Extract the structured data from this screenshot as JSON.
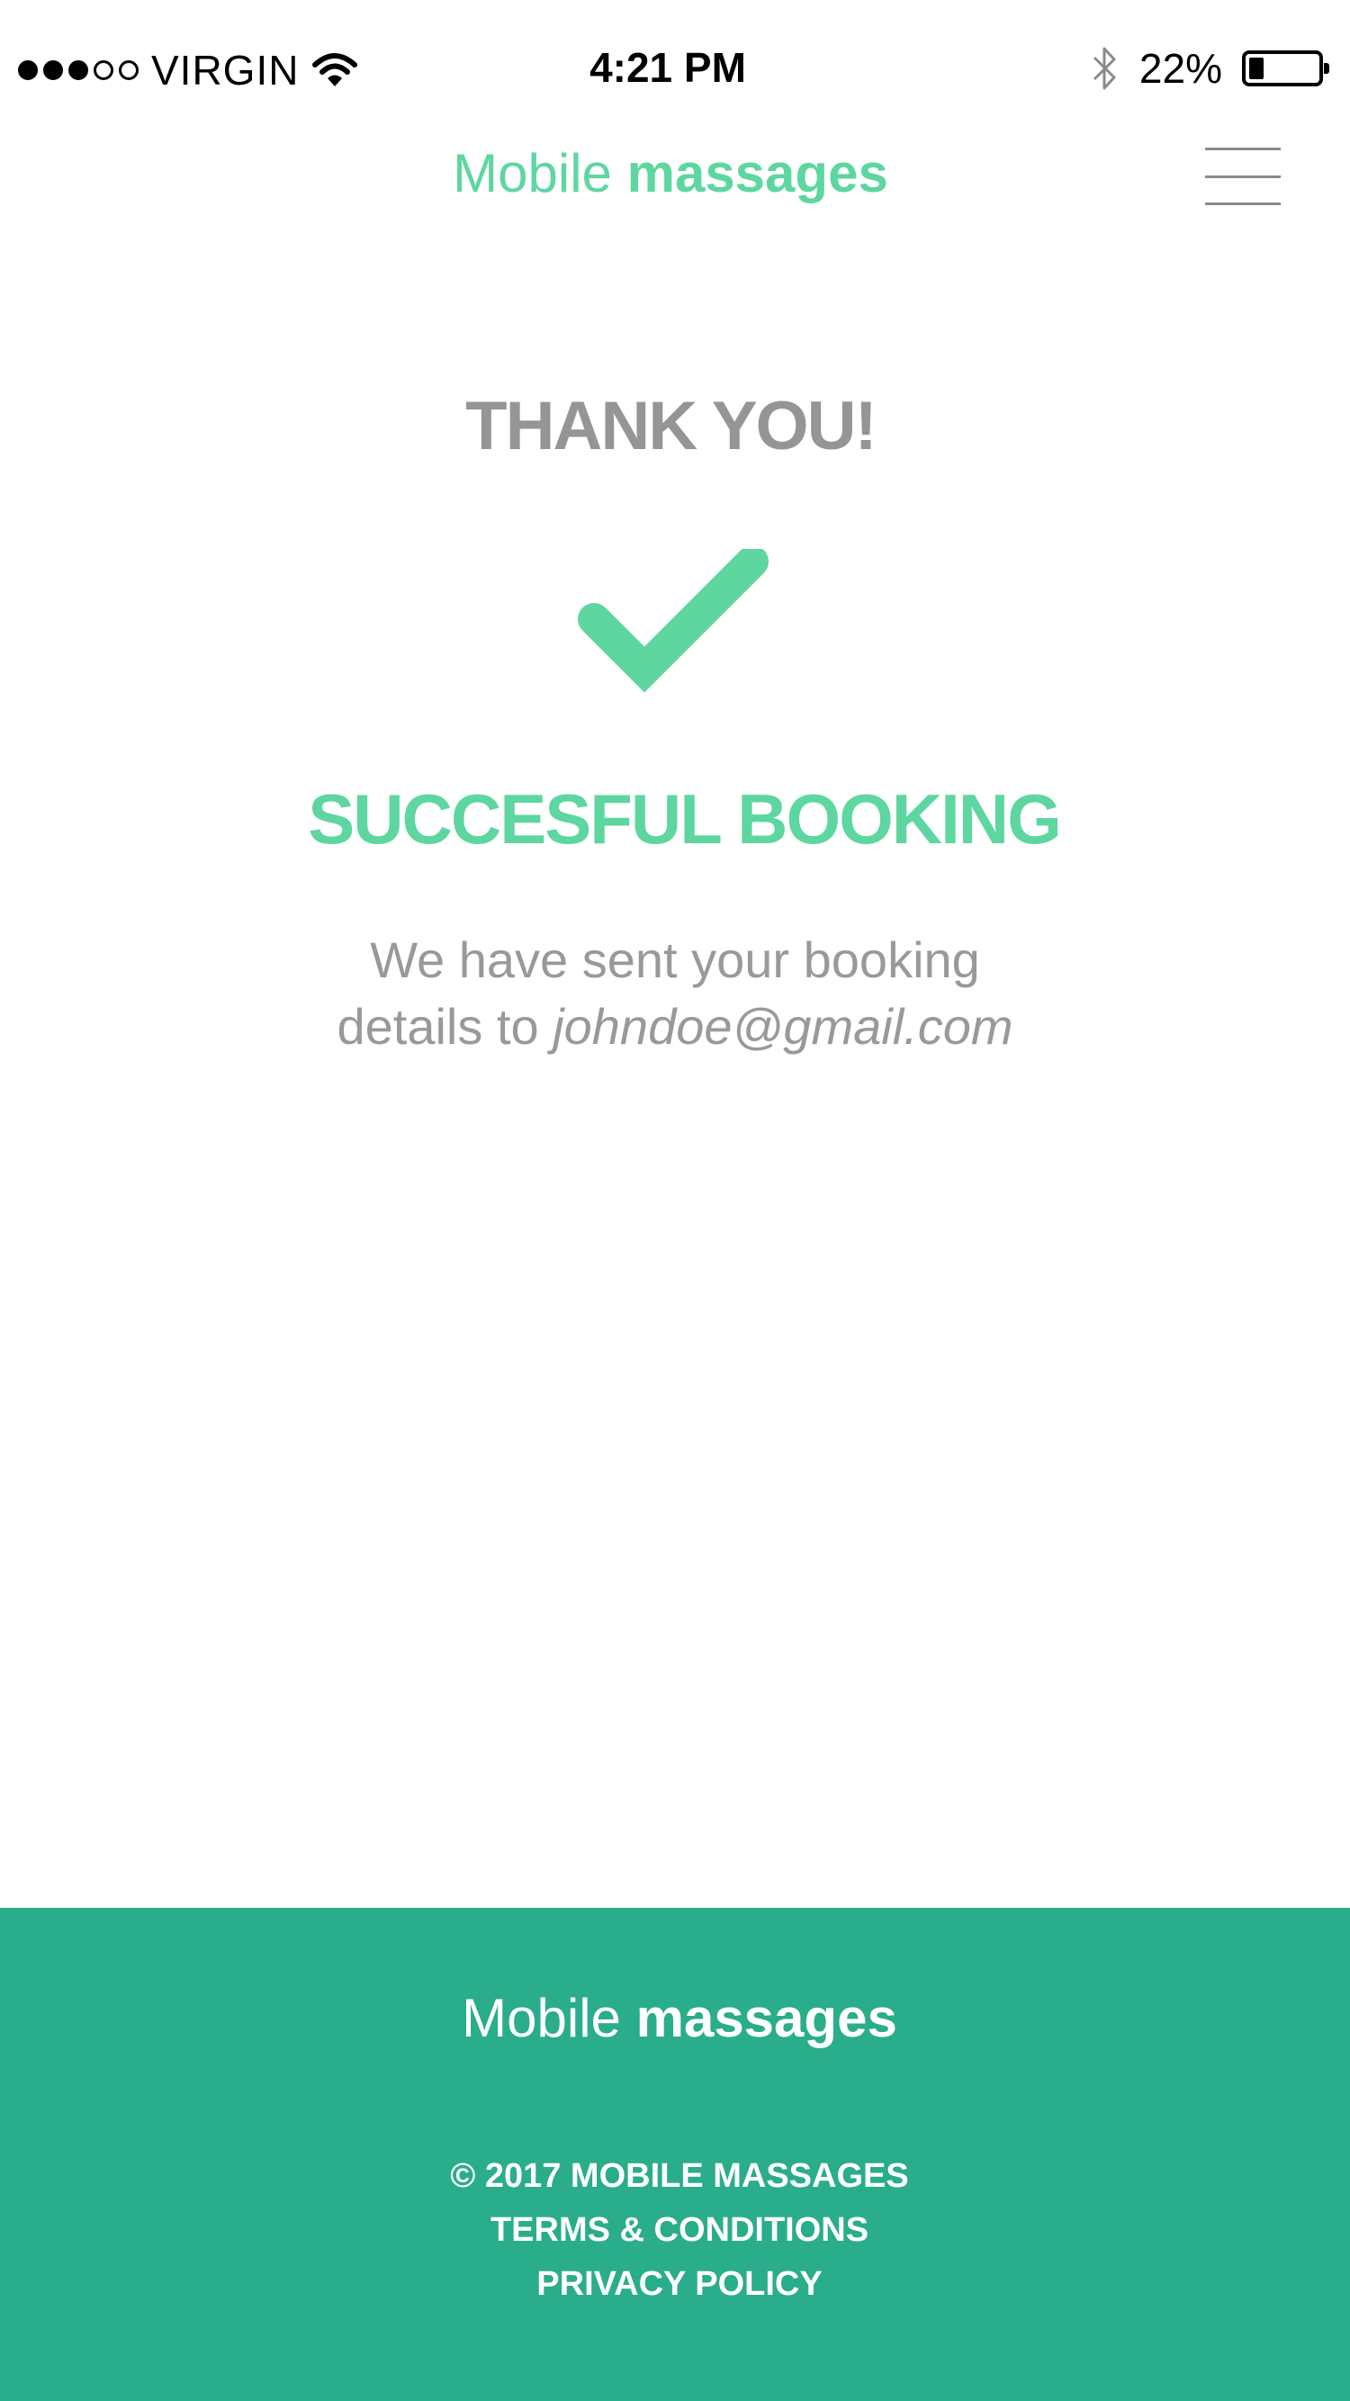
{
  "status_bar": {
    "carrier": "VIRGIN",
    "time": "4:21 PM",
    "battery": "22%",
    "battery_level": 0.22,
    "signal_bars_filled": 3,
    "signal_bars_total": 5
  },
  "header": {
    "brand_light": "Mobile",
    "brand_bold": "massages"
  },
  "confirmation": {
    "heading": "THANK YOU!",
    "status": "SUCCESFUL BOOKING",
    "message_line1": "We have sent your booking",
    "message_line2_prefix": "details to",
    "email": "johndoe@gmail.com"
  },
  "footer": {
    "brand_light": "Mobile",
    "brand_bold": "massages",
    "copyright": "© 2017 MOBILE MASSAGES",
    "terms": "TERMS & CONDITIONS",
    "privacy": "PRIVACY POLICY"
  },
  "colors": {
    "accent": "#5ed6a0",
    "footer_bg": "#2aad8a",
    "text_gray": "#959595"
  },
  "icons": {
    "check": "checkmark-icon",
    "menu": "hamburger-menu-icon",
    "wifi": "wifi-icon",
    "bluetooth": "bluetooth-icon",
    "battery": "battery-icon"
  }
}
